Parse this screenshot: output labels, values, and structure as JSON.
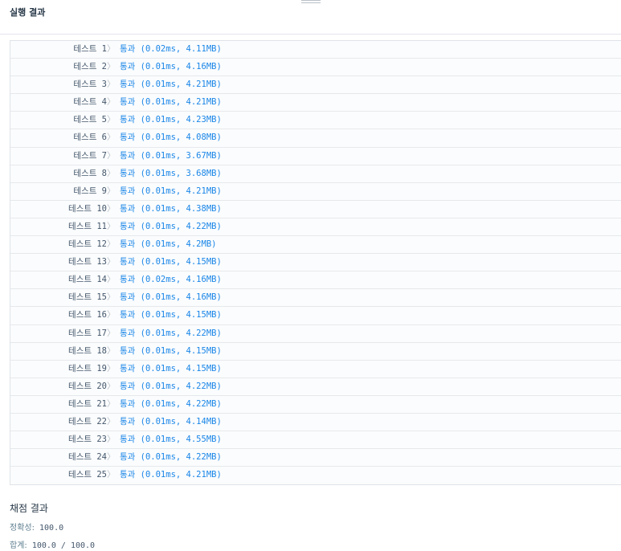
{
  "header": {
    "title": "실행 결과"
  },
  "tests": [
    {
      "name": "테스트 1",
      "sep": "〉",
      "result": "통과 (0.02ms, 4.11MB)"
    },
    {
      "name": "테스트 2",
      "sep": "〉",
      "result": "통과 (0.01ms, 4.16MB)"
    },
    {
      "name": "테스트 3",
      "sep": "〉",
      "result": "통과 (0.01ms, 4.21MB)"
    },
    {
      "name": "테스트 4",
      "sep": "〉",
      "result": "통과 (0.01ms, 4.21MB)"
    },
    {
      "name": "테스트 5",
      "sep": "〉",
      "result": "통과 (0.01ms, 4.23MB)"
    },
    {
      "name": "테스트 6",
      "sep": "〉",
      "result": "통과 (0.01ms, 4.08MB)"
    },
    {
      "name": "테스트 7",
      "sep": "〉",
      "result": "통과 (0.01ms, 3.67MB)"
    },
    {
      "name": "테스트 8",
      "sep": "〉",
      "result": "통과 (0.01ms, 3.68MB)"
    },
    {
      "name": "테스트 9",
      "sep": "〉",
      "result": "통과 (0.01ms, 4.21MB)"
    },
    {
      "name": "테스트 10",
      "sep": "〉",
      "result": "통과 (0.01ms, 4.38MB)"
    },
    {
      "name": "테스트 11",
      "sep": "〉",
      "result": "통과 (0.01ms, 4.22MB)"
    },
    {
      "name": "테스트 12",
      "sep": "〉",
      "result": "통과 (0.01ms, 4.2MB)"
    },
    {
      "name": "테스트 13",
      "sep": "〉",
      "result": "통과 (0.01ms, 4.15MB)"
    },
    {
      "name": "테스트 14",
      "sep": "〉",
      "result": "통과 (0.02ms, 4.16MB)"
    },
    {
      "name": "테스트 15",
      "sep": "〉",
      "result": "통과 (0.01ms, 4.16MB)"
    },
    {
      "name": "테스트 16",
      "sep": "〉",
      "result": "통과 (0.01ms, 4.15MB)"
    },
    {
      "name": "테스트 17",
      "sep": "〉",
      "result": "통과 (0.01ms, 4.22MB)"
    },
    {
      "name": "테스트 18",
      "sep": "〉",
      "result": "통과 (0.01ms, 4.15MB)"
    },
    {
      "name": "테스트 19",
      "sep": "〉",
      "result": "통과 (0.01ms, 4.15MB)"
    },
    {
      "name": "테스트 20",
      "sep": "〉",
      "result": "통과 (0.01ms, 4.22MB)"
    },
    {
      "name": "테스트 21",
      "sep": "〉",
      "result": "통과 (0.01ms, 4.22MB)"
    },
    {
      "name": "테스트 22",
      "sep": "〉",
      "result": "통과 (0.01ms, 4.14MB)"
    },
    {
      "name": "테스트 23",
      "sep": "〉",
      "result": "통과 (0.01ms, 4.55MB)"
    },
    {
      "name": "테스트 24",
      "sep": "〉",
      "result": "통과 (0.01ms, 4.22MB)"
    },
    {
      "name": "테스트 25",
      "sep": "〉",
      "result": "통과 (0.01ms, 4.21MB)"
    }
  ],
  "summary": {
    "title": "채점 결과",
    "accuracy_label": "정확성:",
    "accuracy_value": "100.0",
    "total_label": "합계:",
    "total_value": "100.0 / 100.0"
  },
  "colors": {
    "pass": "#1a86e8",
    "text": "#44576c",
    "title": "#263747"
  }
}
